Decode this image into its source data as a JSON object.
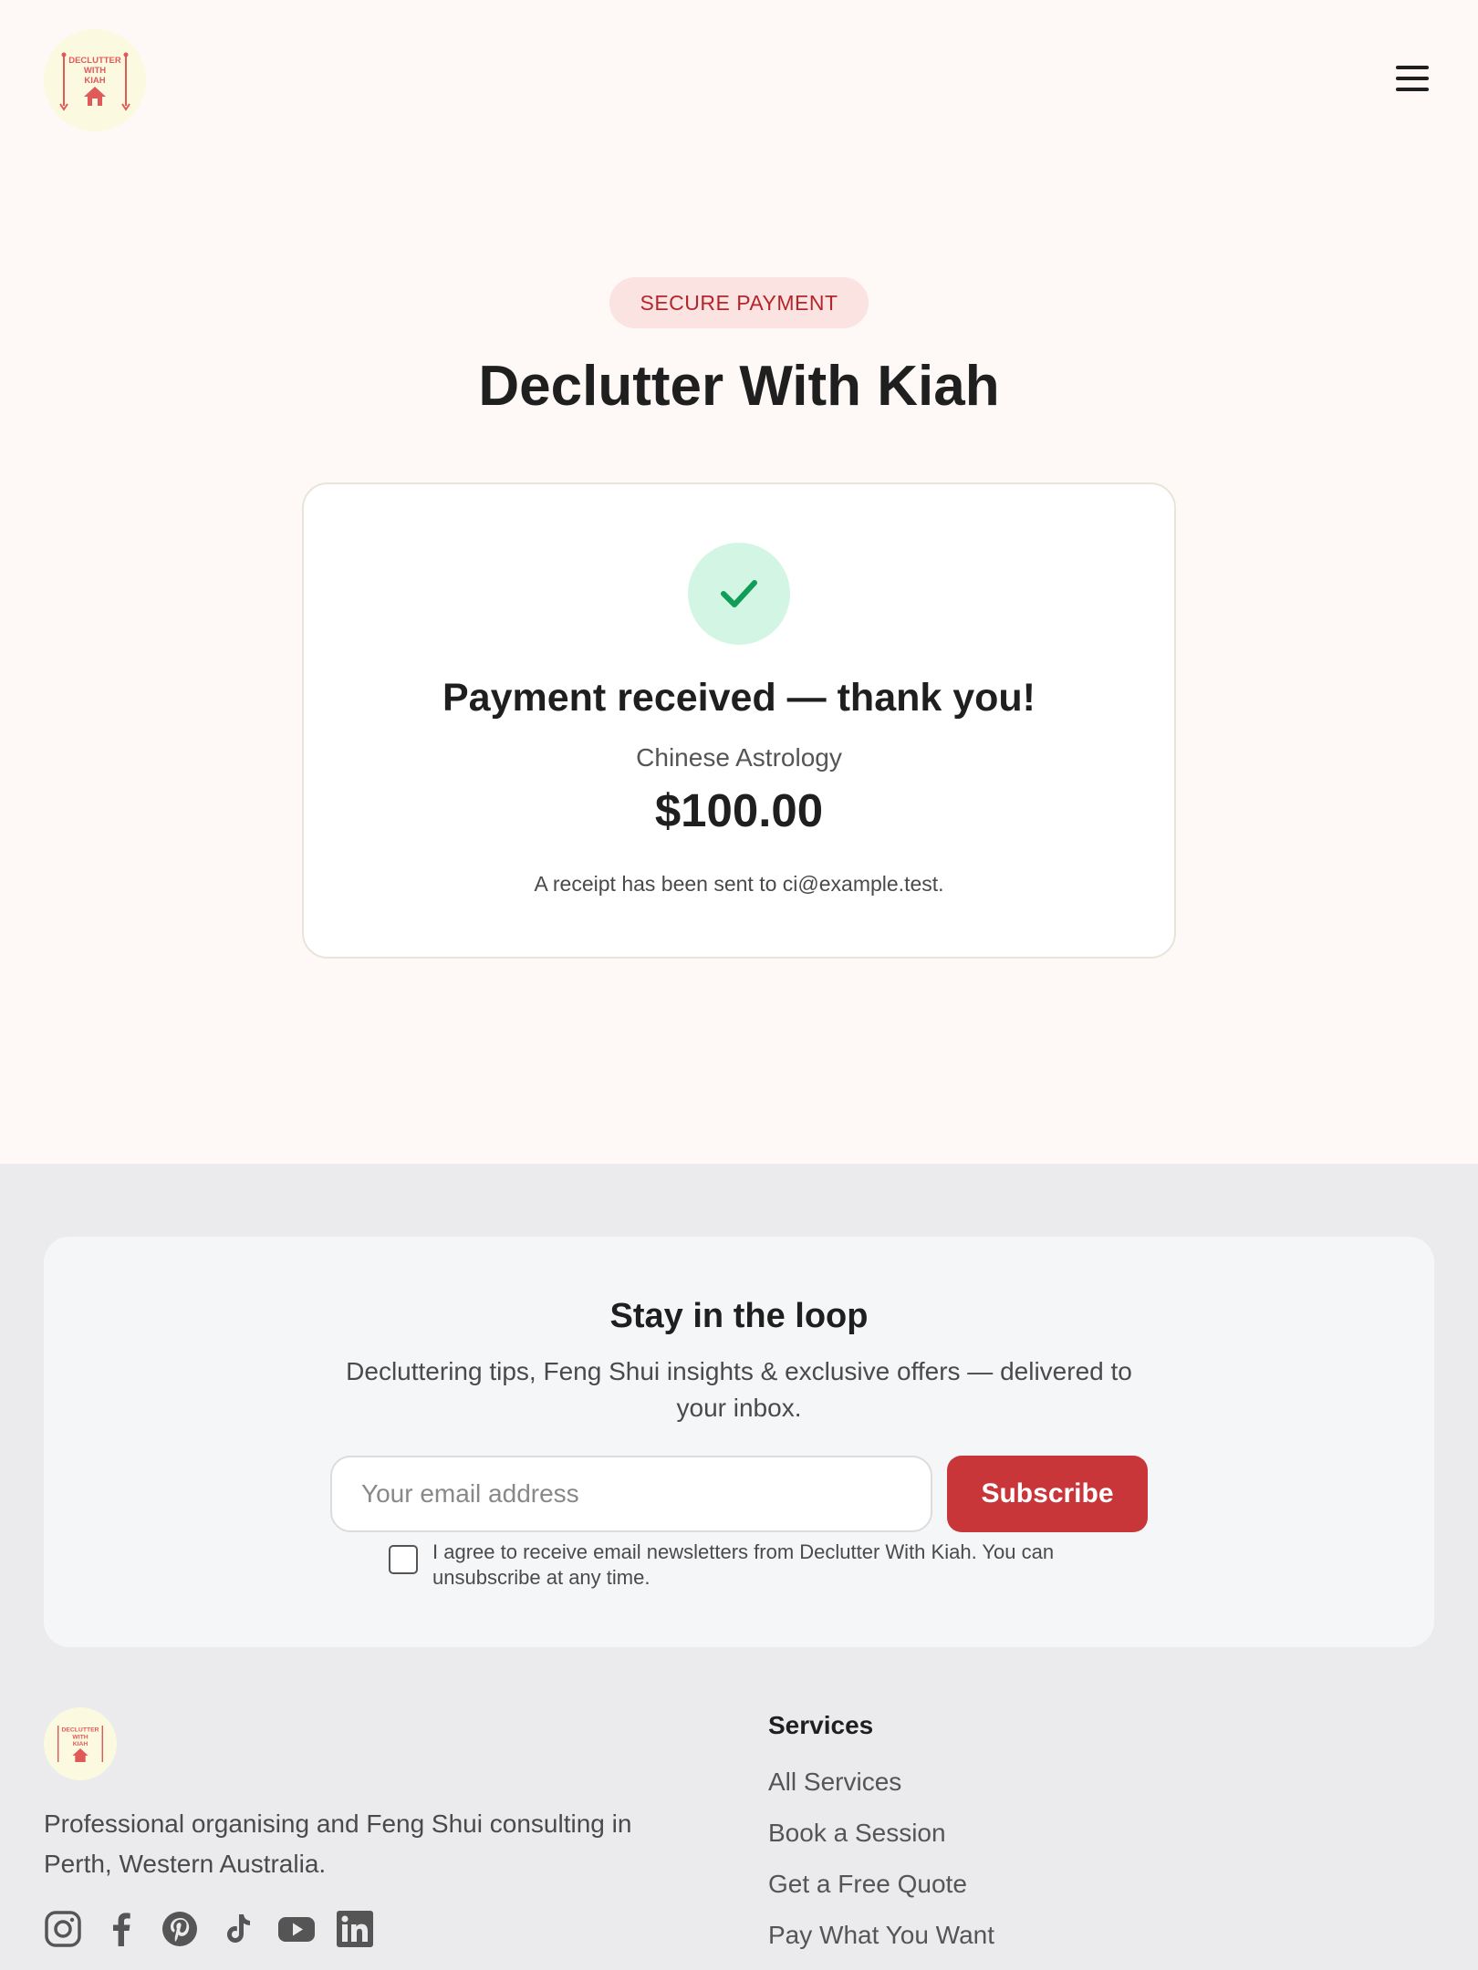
{
  "header": {
    "logo_text": [
      "DECLUTTER",
      "WITH",
      "KIAH"
    ],
    "menu_icon": "hamburger-menu-icon"
  },
  "hero": {
    "badge": "SECURE PAYMENT",
    "title": "Declutter With Kiah"
  },
  "confirmation": {
    "icon": "check-icon",
    "title": "Payment received — thank you!",
    "service": "Chinese Astrology",
    "amount": "$100.00",
    "receipt": "A receipt has been sent to ci@example.test."
  },
  "newsletter": {
    "title": "Stay in the loop",
    "description": "Decluttering tips, Feng Shui insights & exclusive offers — delivered to your inbox.",
    "email_placeholder": "Your email address",
    "subscribe_label": "Subscribe",
    "consent": "I agree to receive email newsletters from Declutter With Kiah. You can unsubscribe at any time."
  },
  "footer": {
    "about": "Professional organising and Feng Shui consulting in Perth, Western Australia.",
    "social": [
      "instagram-icon",
      "facebook-icon",
      "pinterest-icon",
      "tiktok-icon",
      "youtube-icon",
      "linkedin-icon"
    ],
    "services_heading": "Services",
    "services_links": [
      "All Services",
      "Book a Session",
      "Get a Free Quote",
      "Pay What You Want"
    ]
  },
  "colors": {
    "page_bg": "#fef8f7",
    "brand_red": "#c8363a",
    "badge_bg": "#fae3e1",
    "success_bg": "#d3f6e4",
    "success_check": "#0f9d58",
    "footer_bg": "#ebebed"
  }
}
